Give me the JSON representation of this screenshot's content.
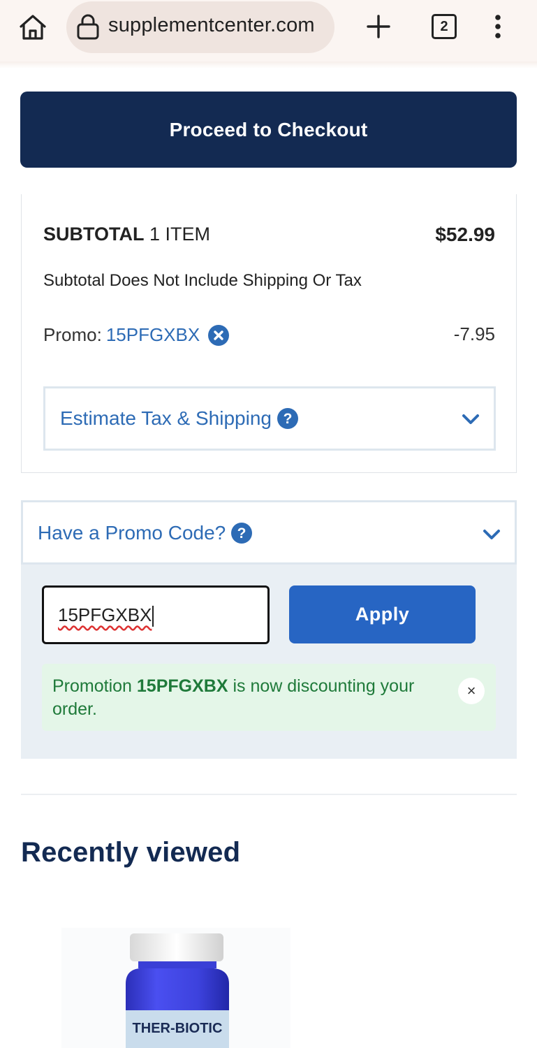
{
  "browser": {
    "url": "supplementcenter.com",
    "tab_count": "2",
    "icons": [
      "home-icon",
      "lock-icon",
      "plus-icon",
      "tabs-icon",
      "more-vert-icon"
    ]
  },
  "checkout": {
    "button_label": "Proceed to Checkout"
  },
  "summary": {
    "subtotal_label": "SUBTOTAL",
    "item_count": "1 ITEM",
    "subtotal_value": "$52.99",
    "note": "Subtotal Does Not Include Shipping Or Tax",
    "promo_label": "Promo:",
    "promo_code": "15PFGXBX",
    "promo_amount": "-7.95",
    "estimate_label": "Estimate Tax & Shipping"
  },
  "promo_section": {
    "header_label": "Have a Promo Code?",
    "input_value": "15PFGXBX",
    "apply_label": "Apply",
    "success_prefix": "Promotion ",
    "success_code": "15PFGXBX",
    "success_suffix": " is now discounting your order.",
    "close_label": "×"
  },
  "recently_viewed": {
    "title": "Recently viewed",
    "product_label": "THER-BIOTIC"
  },
  "colors": {
    "navy": "#132a52",
    "link_blue": "#2d6bb5",
    "apply_blue": "#2765c3",
    "success_green": "#1f7a3a"
  }
}
